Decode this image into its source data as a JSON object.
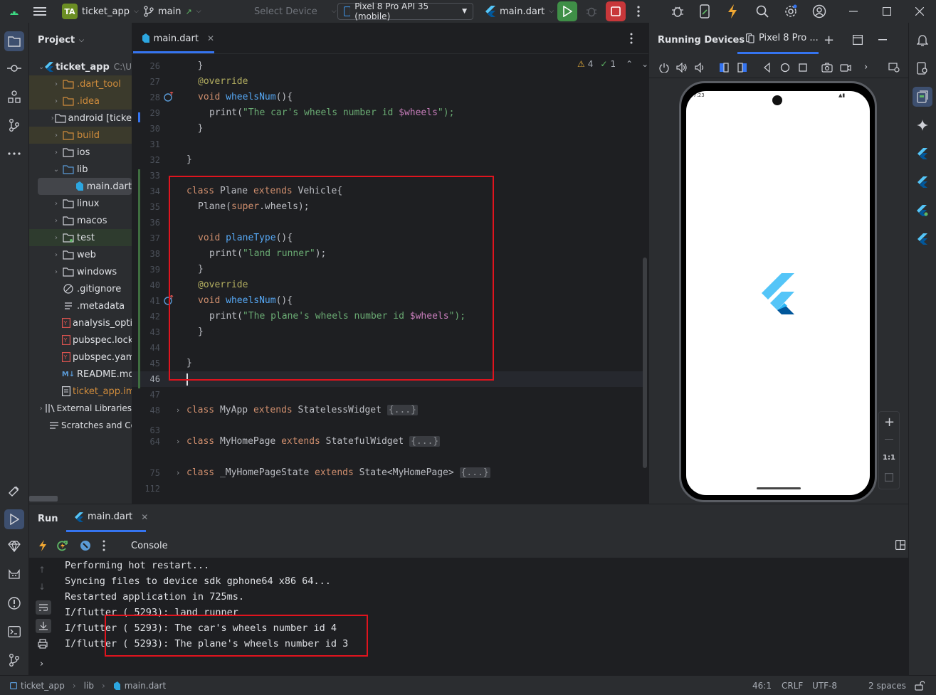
{
  "titlebar": {
    "project_badge": "TA",
    "project_name": "ticket_app",
    "branch": "main",
    "select_device_placeholder": "Select Device",
    "device": "Pixel 8 Pro API 35 (mobile)",
    "run_config": "main.dart"
  },
  "project_panel": {
    "title": "Project",
    "root_name": "ticket_app",
    "root_path": "C:\\U",
    "items": [
      {
        "label": ".dart_tool"
      },
      {
        "label": ".idea"
      },
      {
        "label": "android [ticke"
      },
      {
        "label": "build"
      },
      {
        "label": "ios"
      },
      {
        "label": "lib"
      },
      {
        "label": "main.dart"
      },
      {
        "label": "linux"
      },
      {
        "label": "macos"
      },
      {
        "label": "test"
      },
      {
        "label": "web"
      },
      {
        "label": "windows"
      },
      {
        "label": ".gitignore"
      },
      {
        "label": ".metadata"
      },
      {
        "label": "analysis_optio"
      },
      {
        "label": "pubspec.lock"
      },
      {
        "label": "pubspec.yaml"
      },
      {
        "label": "README.md"
      },
      {
        "label": "ticket_app.iml"
      },
      {
        "label": "External Libraries"
      },
      {
        "label": "Scratches and Co"
      }
    ]
  },
  "editor": {
    "tab_label": "main.dart",
    "warnings_count": "4",
    "weak_warnings_count": "1",
    "line_numbers": [
      "26",
      "27",
      "28",
      "29",
      "30",
      "31",
      "32",
      "33",
      "34",
      "35",
      "36",
      "37",
      "38",
      "39",
      "40",
      "41",
      "42",
      "43",
      "44",
      "45",
      "46",
      "47",
      "48",
      "63",
      "64",
      "75",
      "112"
    ],
    "code": {
      "l26": "  }",
      "l27_ann": "@override",
      "l28_kw": "void",
      "l28_fn": "wheelsNum",
      "l28_rest": "(){",
      "l29_a": "print(",
      "l29_str": "\"The car's wheels number id ",
      "l29_var": "$wheels",
      "l29_end": "\");",
      "l30": "  }",
      "l32": "}",
      "l34_kw1": "class",
      "l34_name": " Plane ",
      "l34_kw2": "extends",
      "l34_rest": " Vehicle{",
      "l35_a": "Plane(",
      "l35_kw": "super",
      "l35_b": ".wheels);",
      "l37_kw": "void",
      "l37_fn": "planeType",
      "l37_rest": "(){",
      "l38_a": "print(",
      "l38_str": "\"land runner\"",
      "l38_end": ");",
      "l39": "}",
      "l40_ann": "@override",
      "l41_kw": "void",
      "l41_fn": "wheelsNum",
      "l41_rest": "(){",
      "l42_a": "print(",
      "l42_str": "\"The plane's wheels number id ",
      "l42_var": "$wheels",
      "l42_end": "\");",
      "l43": "}",
      "l45": "}",
      "l48_kw1": "class",
      "l48_name": " MyApp ",
      "l48_kw2": "extends",
      "l48_rest": " StatelessWidget ",
      "l64_kw1": "class",
      "l64_name": " MyHomePage ",
      "l64_kw2": "extends",
      "l64_rest": " StatefulWidget ",
      "l75_kw1": "class",
      "l75_name": " _MyHomePageState ",
      "l75_kw2": "extends",
      "l75_rest": " State<MyHomePage> ",
      "fold": "{...}"
    }
  },
  "devices_panel": {
    "title": "Running Devices",
    "device_tab": "Pixel 8 Pro ...",
    "zoom_label": "1:1",
    "phone_status_time": "7:23"
  },
  "run_panel": {
    "tab_run": "Run",
    "tab_file": "main.dart",
    "console_label": "Console",
    "console_lines": [
      "Performing hot restart...",
      "Syncing files to device sdk gphone64 x86 64...",
      "Restarted application in 725ms.",
      "I/flutter ( 5293): land runner",
      "I/flutter ( 5293): The car's wheels number id 4",
      "I/flutter ( 5293): The plane's wheels number id 3"
    ]
  },
  "statusbar": {
    "crumb_project": "ticket_app",
    "crumb_dir": "lib",
    "crumb_file": "main.dart",
    "position": "46:1",
    "line_sep": "CRLF",
    "encoding": "UTF-8",
    "indent": "2 spaces"
  }
}
